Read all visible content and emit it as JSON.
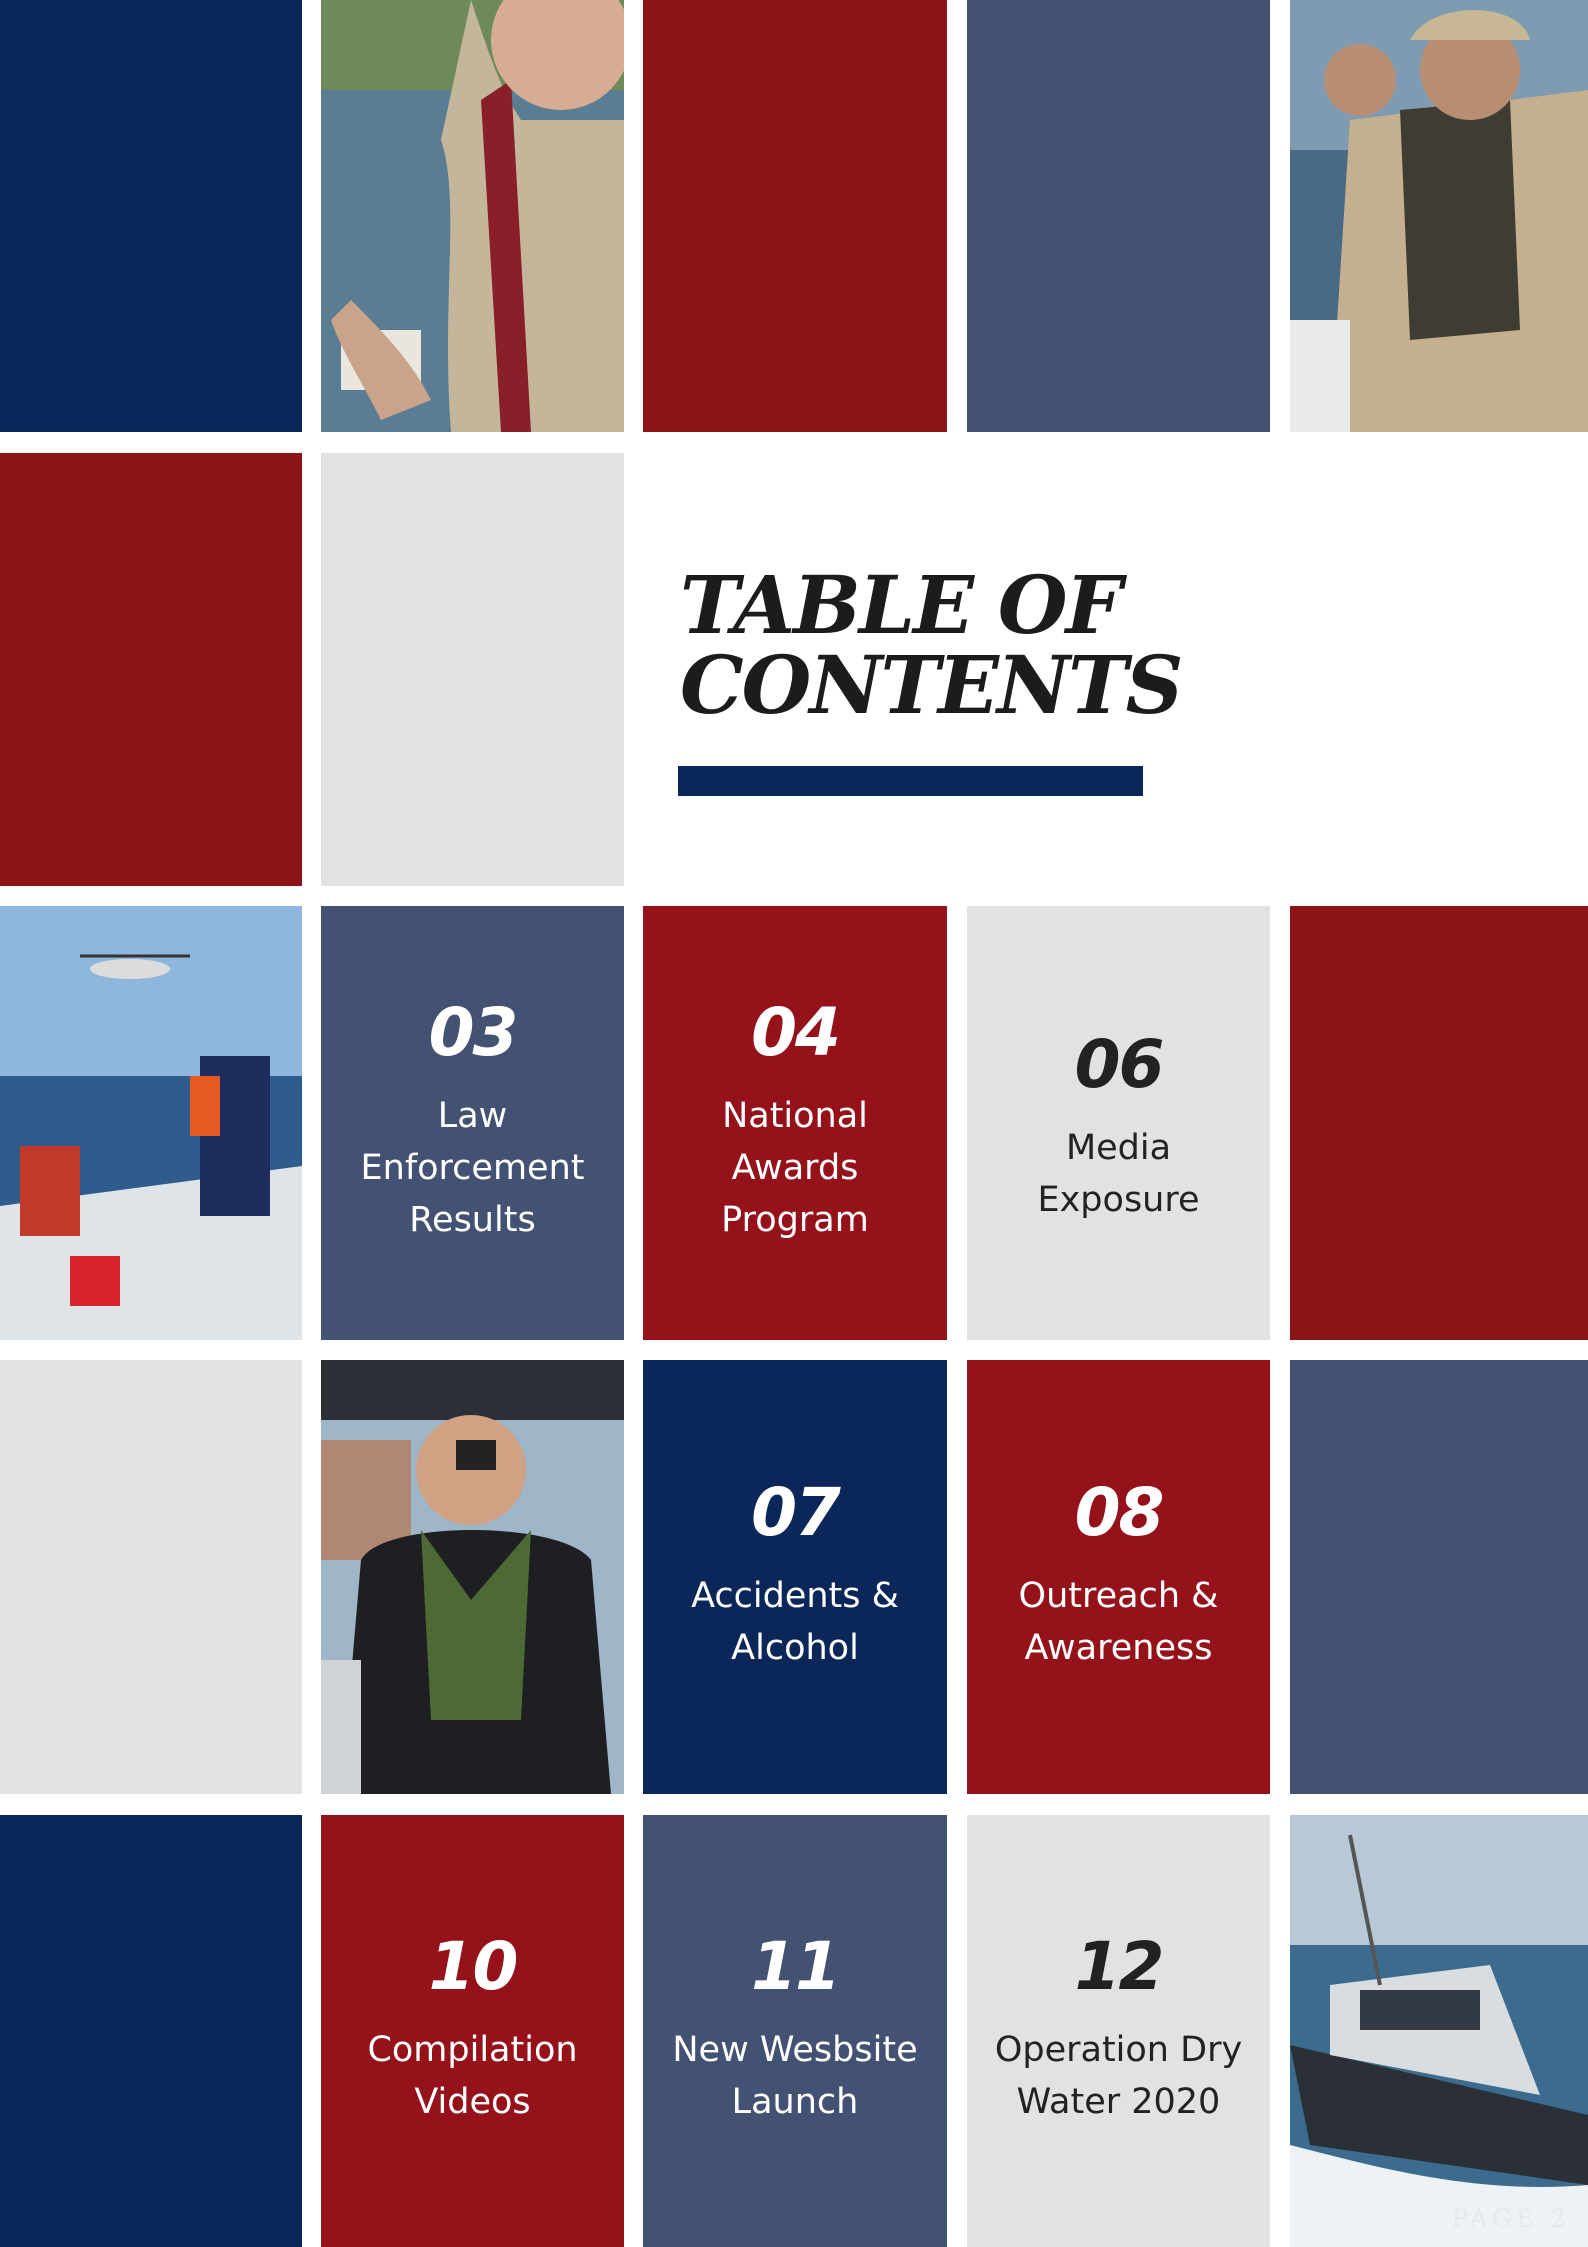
{
  "title": {
    "line1": "TABLE OF",
    "line2": "CONTENTS"
  },
  "entries": [
    {
      "number": "03",
      "label_lines": [
        "Law",
        "Enforcement",
        "Results"
      ]
    },
    {
      "number": "04",
      "label_lines": [
        "National",
        "Awards",
        "Program"
      ]
    },
    {
      "number": "06",
      "label_lines": [
        "Media Exposure"
      ]
    },
    {
      "number": "07",
      "label_lines": [
        "Accidents &",
        "Alcohol"
      ]
    },
    {
      "number": "08",
      "label_lines": [
        "Outreach &",
        "Awareness"
      ]
    },
    {
      "number": "10",
      "label_lines": [
        "Compilation",
        "Videos"
      ]
    },
    {
      "number": "11",
      "label_lines": [
        "New Wesbsite",
        "Launch"
      ]
    },
    {
      "number": "12",
      "label_lines": [
        "Operation Dry",
        "Water 2020"
      ]
    }
  ],
  "page_label": "PAGE 2",
  "colors": {
    "navy": "#0b2659",
    "red": "#8b1519",
    "slate": "#435173",
    "light": "#e2e2e2"
  }
}
